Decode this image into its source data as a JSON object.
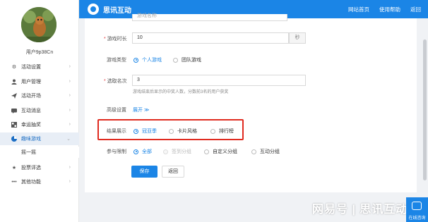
{
  "app": {
    "name": "思讯互动",
    "header_links": [
      "网站首页",
      "使用帮助",
      "返回"
    ]
  },
  "user": {
    "name": "用户9p38Cn"
  },
  "sidebar": {
    "items": [
      {
        "label": "活动设置",
        "icon": "gear-icon"
      },
      {
        "label": "用户管理",
        "icon": "user-icon"
      },
      {
        "label": "活动开场",
        "icon": "send-icon"
      },
      {
        "label": "互动消息",
        "icon": "message-icon"
      },
      {
        "label": "幸运抽奖",
        "icon": "grid-icon"
      },
      {
        "label": "趣味游戏",
        "icon": "pie-icon",
        "active": true
      },
      {
        "label": "投票评选",
        "icon": "star-icon"
      },
      {
        "label": "其他功能",
        "icon": "more-icon"
      }
    ],
    "sub_item": "摇一摇"
  },
  "form": {
    "top_partial_value": "游戏名称",
    "duration": {
      "label": "游戏时长",
      "value": "10",
      "unit": "秒"
    },
    "type": {
      "label": "游戏类型",
      "options": [
        "个人游戏",
        "团队游戏"
      ]
    },
    "ranking": {
      "label": "选取名次",
      "value": "3",
      "hint": "游戏结束后显示的中奖人数，分数前3名的用户获奖"
    },
    "advanced": {
      "label": "高级设置",
      "toggle": "展开 ≫"
    },
    "result_display": {
      "label": "结果展示",
      "options": [
        "冠亚季",
        "卡片风格",
        "排行榜"
      ]
    },
    "participation": {
      "label": "参与限制",
      "options": [
        "全部",
        "签到分组",
        "自定义分组",
        "互动分组"
      ]
    },
    "save": "保存",
    "back": "返回"
  },
  "watermark": "网易号 | 思讯互动",
  "online_service": "在线咨询",
  "colors": {
    "brand": "#1b85e6",
    "highlight": "#e02b20"
  }
}
